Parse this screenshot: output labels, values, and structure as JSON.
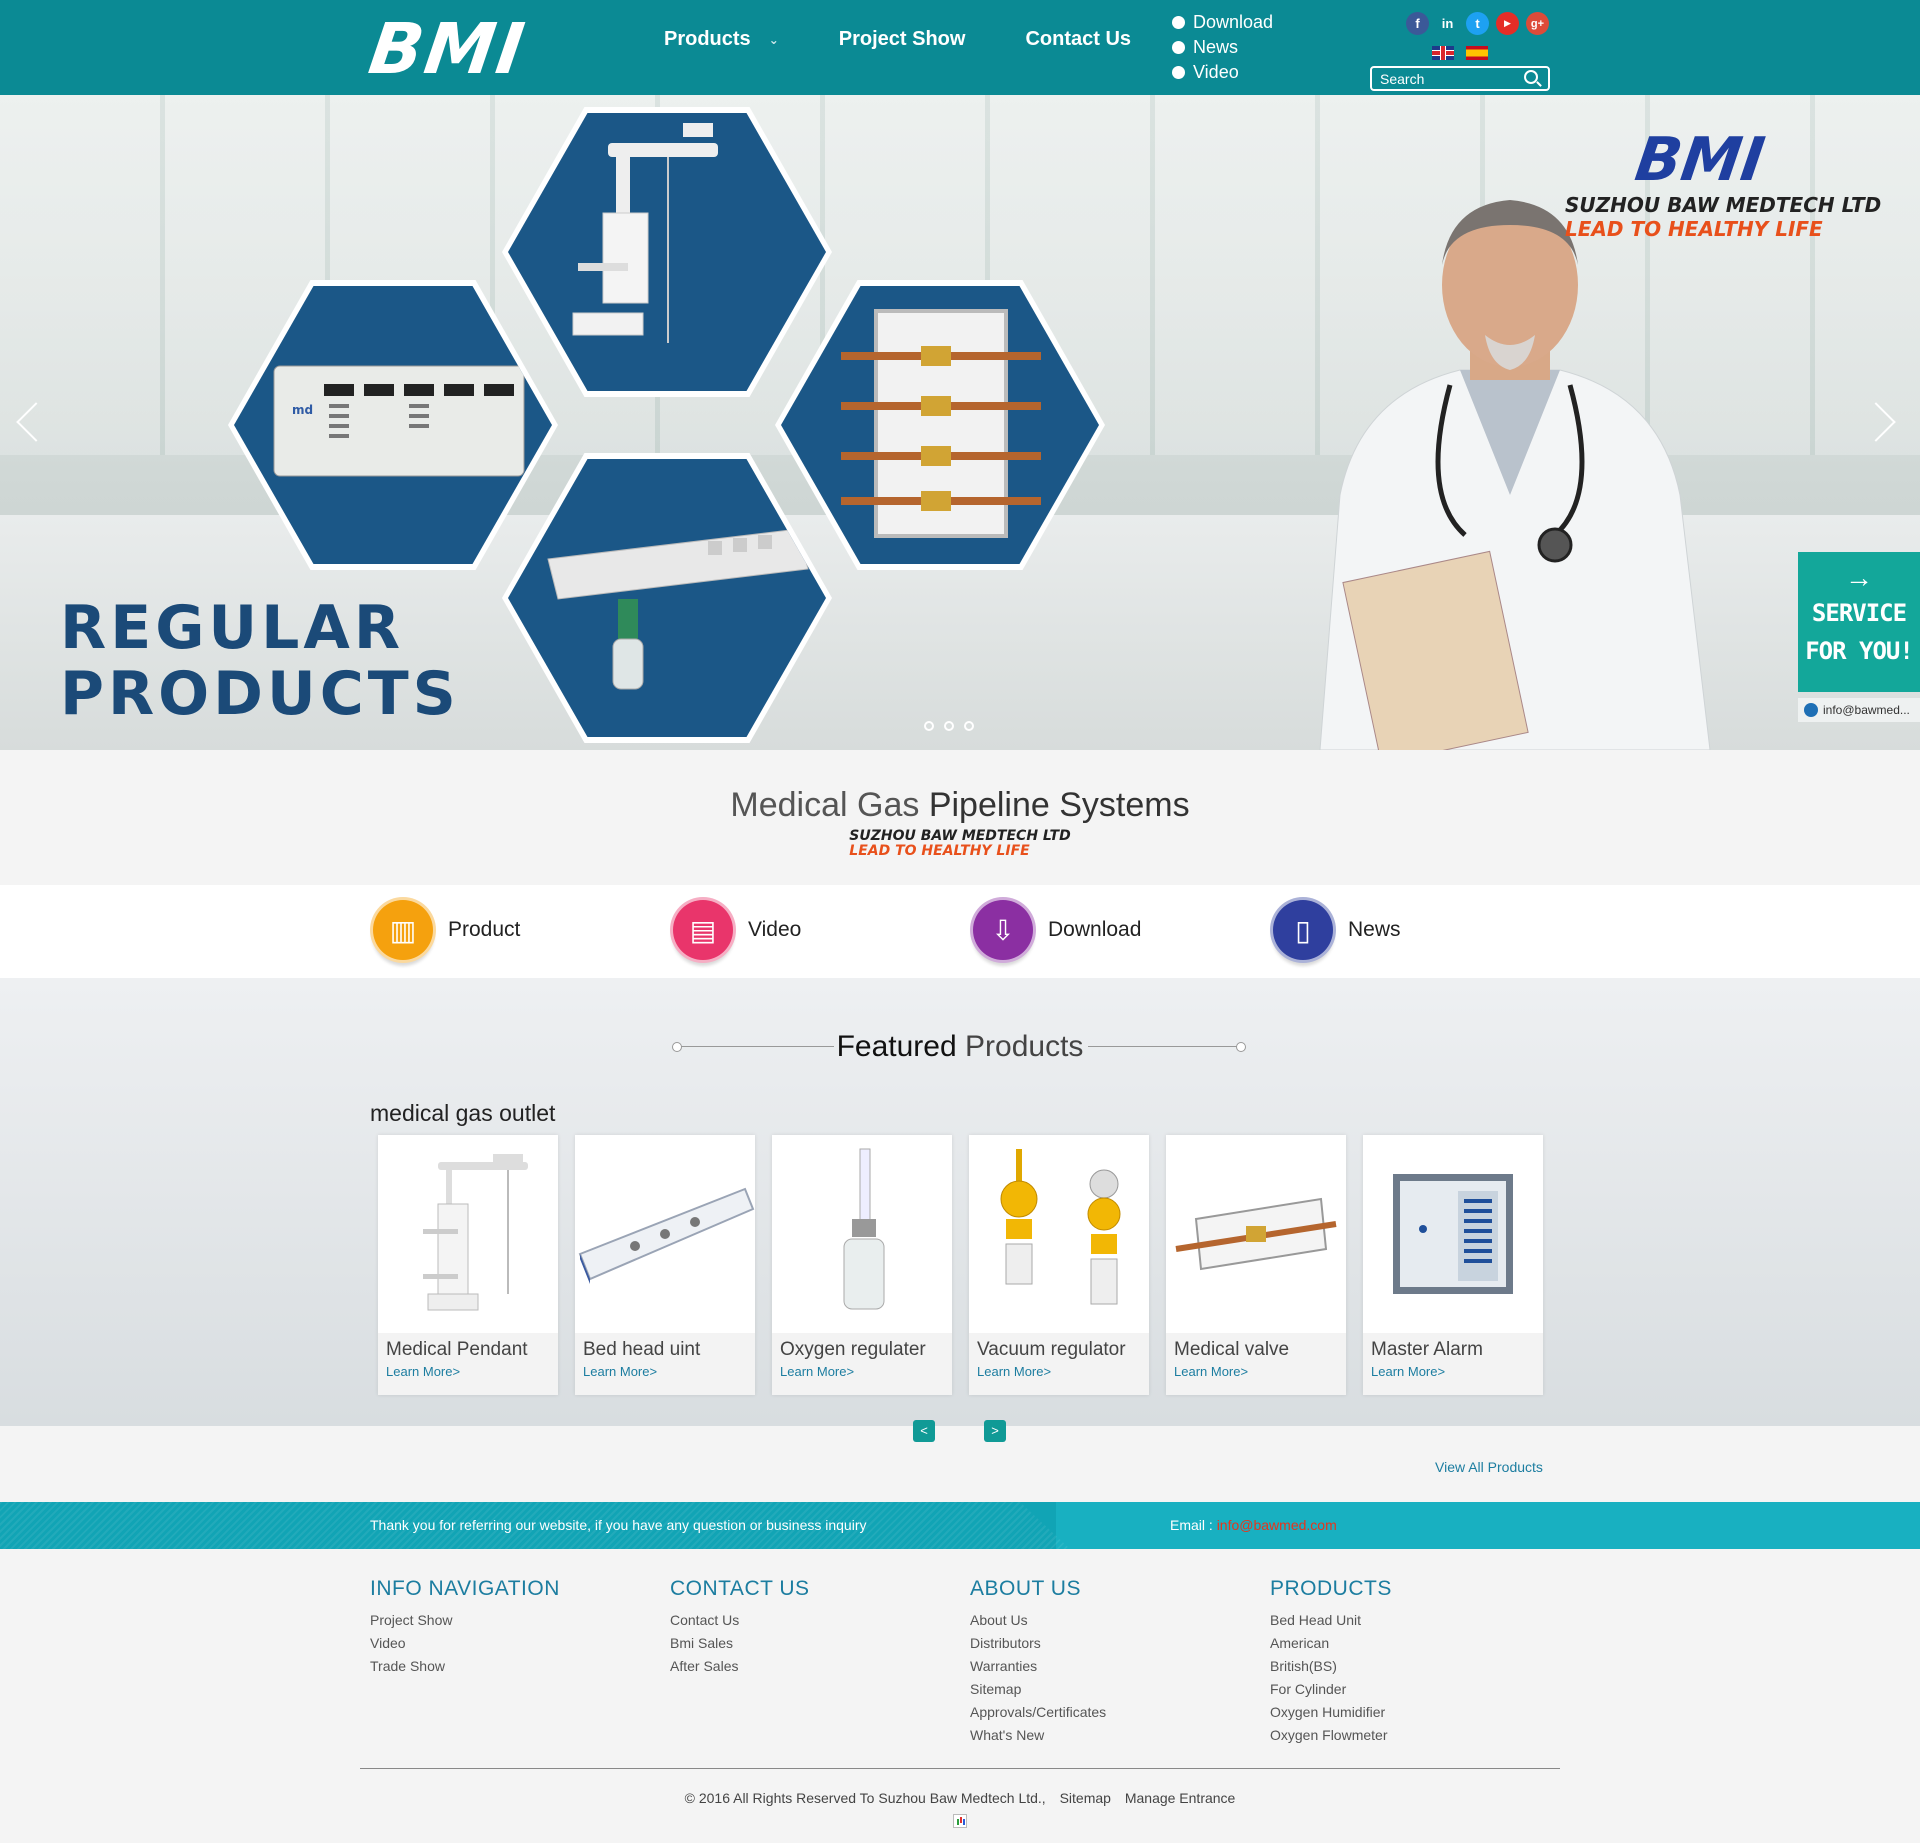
{
  "header": {
    "logo_text": "BMI",
    "nav": [
      {
        "label": "Products"
      },
      {
        "label": "Project Show"
      },
      {
        "label": "Contact Us"
      }
    ],
    "subnav": [
      "Download",
      "News",
      "Video"
    ],
    "social": [
      {
        "icon": "facebook-icon",
        "glyph": "f",
        "color": "#3b5998"
      },
      {
        "icon": "linkedin-icon",
        "glyph": "in",
        "color": "#0b8a94"
      },
      {
        "icon": "twitter-icon",
        "glyph": "t",
        "color": "#1da1f2"
      },
      {
        "icon": "youtube-icon",
        "glyph": "▶",
        "color": "#e52d27"
      },
      {
        "icon": "googleplus-icon",
        "glyph": "g+",
        "color": "#dd4b39"
      }
    ],
    "search_placeholder": "Search"
  },
  "hero": {
    "title_line1": "REGULAR",
    "title_line2": "PRODUCTS",
    "brand": "BMI",
    "tag_line1": "SUZHOU BAW MEDTECH LTD",
    "tag_line2": "LEAD TO HEALTHY LIFE"
  },
  "service": {
    "line1": "SERVICE",
    "line2": "FOR YOU!",
    "email": "info@bawmed..."
  },
  "intro": {
    "title_light": "Medical Gas",
    "title_bold": "Pipeline Systems",
    "tag_line1": "SUZHOU BAW MEDTECH LTD",
    "tag_line2": "LEAD TO HEALTHY LIFE"
  },
  "quick_links": [
    {
      "label": "Product",
      "color": "#f5a10e",
      "icon": "barcode-icon",
      "glyph": "▥"
    },
    {
      "label": "Video",
      "color": "#e9356b",
      "icon": "video-clapper-icon",
      "glyph": "▤"
    },
    {
      "label": "Download",
      "color": "#8b2fa2",
      "icon": "download-tray-icon",
      "glyph": "⇩"
    },
    {
      "label": "News",
      "color": "#2f3f9e",
      "icon": "book-icon",
      "glyph": "▯"
    }
  ],
  "featured": {
    "title_bold": "Featured",
    "title_light": "Products",
    "category": "medical gas outlet",
    "products": [
      {
        "name": "Medical Pendant",
        "more": "Learn More>"
      },
      {
        "name": "Bed head uint",
        "more": "Learn More>"
      },
      {
        "name": "Oxygen regulater",
        "more": "Learn More>"
      },
      {
        "name": "Vacuum regulator",
        "more": "Learn More>"
      },
      {
        "name": "Medical valve",
        "more": "Learn More>"
      },
      {
        "name": "Master Alarm",
        "more": "Learn More>"
      }
    ],
    "prev": "<",
    "next": ">",
    "view_all": "View All Products"
  },
  "inquiry": {
    "message": "Thank you for referring our website, if you have any question or business inquiry",
    "email_label": "Email :",
    "email_value": "info@bawmed.com"
  },
  "footer": {
    "columns": [
      {
        "title": "INFO NAVIGATION",
        "links": [
          "Project Show",
          "Video",
          "Trade Show"
        ]
      },
      {
        "title": "CONTACT US",
        "links": [
          "Contact Us",
          "Bmi Sales",
          "After Sales"
        ]
      },
      {
        "title": "ABOUT US",
        "links": [
          "About Us",
          "Distributors",
          "Warranties",
          "Sitemap",
          "Approvals/Certificates",
          "What's New"
        ]
      },
      {
        "title": "PRODUCTS",
        "links": [
          "Bed Head Unit",
          "American",
          "British(BS)",
          "For Cylinder",
          "Oxygen Humidifier",
          "Oxygen Flowmeter"
        ]
      }
    ],
    "copyright": "© 2016 All Rights Reserved To Suzhou Baw Medtech Ltd.,",
    "sitemap": "Sitemap",
    "manage": "Manage Entrance"
  }
}
